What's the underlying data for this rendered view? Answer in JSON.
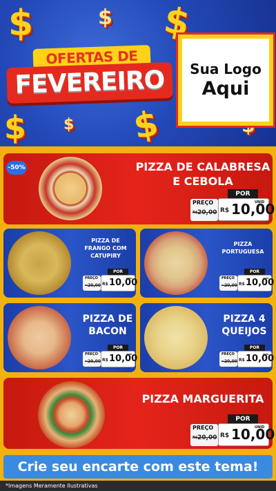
{
  "header": {
    "title_top": "OFERTAS DE",
    "title_main": "FEVEREIRO",
    "logo_line1": "Sua Logo",
    "logo_line2": "Aqui",
    "dollar_symbol": "$"
  },
  "products": [
    {
      "name_line1": "PIZZA DE CALABRESA",
      "name_line2": "E CEBOLA",
      "badge": "-50%",
      "price_label": "PREÇO",
      "old_prefix": "R$",
      "old_value": "20,00",
      "por": "POR",
      "currency": "R$",
      "new_value": "10,00",
      "unit": "UNID"
    },
    {
      "name_line1": "PIZZA DE",
      "name_line2": "FRANGO COM",
      "name_line3": "CATUPIRY",
      "price_label": "PREÇO",
      "old_prefix": "R$",
      "old_value": "20,00",
      "por": "POR",
      "currency": "R$",
      "new_value": "10,00",
      "unit": "UNID"
    },
    {
      "name_line1": "PIZZA",
      "name_line2": "PORTUGUESA",
      "price_label": "PREÇO",
      "old_prefix": "R$",
      "old_value": "20,00",
      "por": "POR",
      "currency": "R$",
      "new_value": "10,00",
      "unit": "UNID"
    },
    {
      "name_line1": "PIZZA DE",
      "name_line2": "BACON",
      "price_label": "PREÇO",
      "old_prefix": "R$",
      "old_value": "20,00",
      "por": "POR",
      "currency": "R$",
      "new_value": "10,00",
      "unit": "UNID"
    },
    {
      "name_line1": "PIZZA 4",
      "name_line2": "QUEIJOS",
      "price_label": "PREÇO",
      "old_prefix": "R$",
      "old_value": "20,00",
      "por": "POR",
      "currency": "R$",
      "new_value": "10,00",
      "unit": "UNID"
    },
    {
      "name_line1": "PIZZA MARGUERITA",
      "price_label": "PREÇO",
      "old_prefix": "R$",
      "old_value": "20,00",
      "por": "POR",
      "currency": "R$",
      "new_value": "10,00",
      "unit": "UNID"
    }
  ],
  "cta": "Crie seu encarte com este tema!",
  "footer": "*Imagens Meramente Ilustrativas",
  "colors": {
    "red": "#e4241b",
    "blue": "#2a55c8",
    "yellow": "#ffd21a",
    "cta": "#3a8be0"
  }
}
